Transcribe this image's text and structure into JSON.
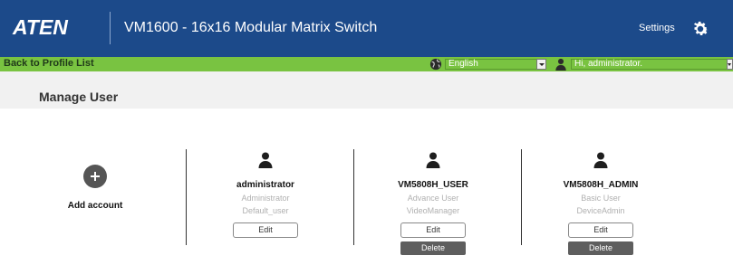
{
  "header": {
    "logo": "ATEN",
    "title": "VM1600 - 16x16 Modular Matrix Switch",
    "settings_label": "Settings",
    "settings_icon": "gear-icon"
  },
  "navbar": {
    "back_label": "Back to Profile List",
    "language_icon": "globe-icon",
    "language_value": "English",
    "user_icon": "user-icon",
    "user_value": "Hi, administrator."
  },
  "page": {
    "title": "Manage User"
  },
  "add_account": {
    "icon": "plus-circle-icon",
    "label": "Add account"
  },
  "users": [
    {
      "icon": "person-icon",
      "name": "administrator",
      "role": "Administrator",
      "group": "Default_user",
      "edit_label": "Edit",
      "delete_label": ""
    },
    {
      "icon": "person-icon",
      "name": "VM5808H_USER",
      "role": "Advance User",
      "group": "VideoManager",
      "edit_label": "Edit",
      "delete_label": "Delete"
    },
    {
      "icon": "person-icon",
      "name": "VM5808H_ADMIN",
      "role": "Basic User",
      "group": "DeviceAdmin",
      "edit_label": "Edit",
      "delete_label": "Delete"
    }
  ],
  "colors": {
    "header_bg": "#1c4a8a",
    "navbar_bg": "#79c341",
    "title_band_bg": "#f1f1f1",
    "delete_bg": "#5e5e5e"
  }
}
